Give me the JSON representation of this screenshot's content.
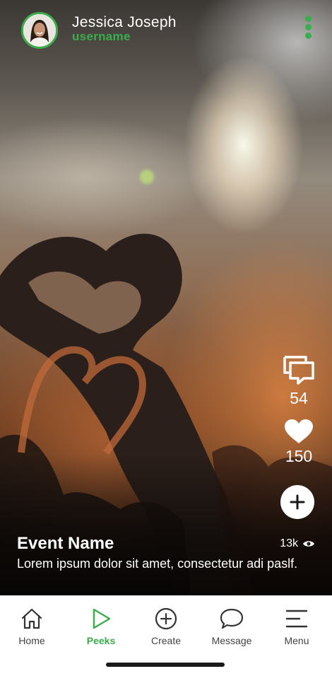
{
  "post": {
    "user_name": "Jessica Joseph",
    "handle": "username",
    "event_name": "Event Name",
    "views": "13k",
    "description": "Lorem ipsum dolor sit amet, consectetur adi paslf."
  },
  "actions": {
    "comments_count": "54",
    "likes_count": "150"
  },
  "nav": {
    "items": [
      {
        "label": "Home",
        "icon": "home-icon"
      },
      {
        "label": "Peeks",
        "icon": "play-icon"
      },
      {
        "label": "Create",
        "icon": "plus-circle-icon"
      },
      {
        "label": "Message",
        "icon": "chat-bubble-icon"
      },
      {
        "label": "Menu",
        "icon": "hamburger-icon"
      }
    ],
    "active": "Peeks"
  },
  "colors": {
    "accent": "#3aad4c",
    "nav_text": "#444444"
  }
}
